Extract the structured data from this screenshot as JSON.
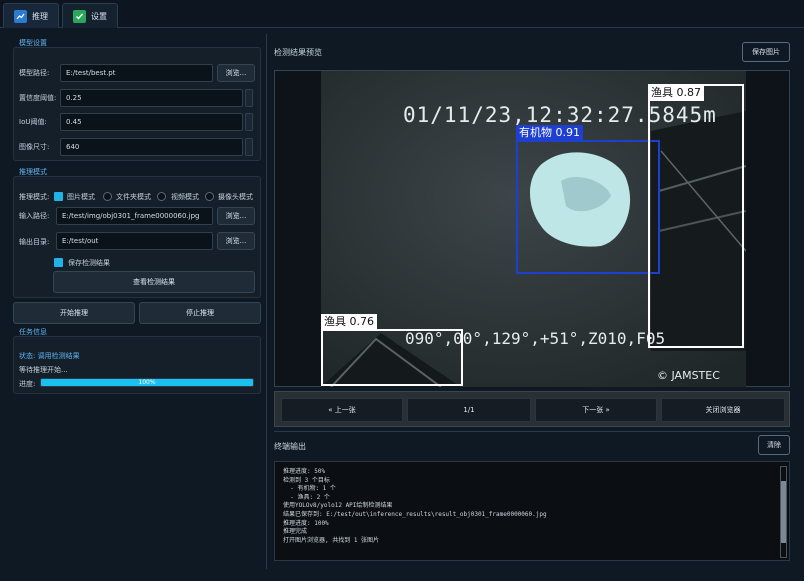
{
  "tabs": [
    {
      "label": "推理",
      "icon": "chart-line-icon"
    },
    {
      "label": "设置",
      "icon": "check-square-icon"
    }
  ],
  "model_settings": {
    "title": "模型设置",
    "model_path_label": "模型路径:",
    "model_path_value": "E:/test/best.pt",
    "browse_label": "浏览...",
    "conf_label": "置信度阈值:",
    "conf_value": "0.25",
    "iou_label": "IoU阈值:",
    "iou_value": "0.45",
    "imgsz_label": "图像尺寸:",
    "imgsz_value": "640"
  },
  "inference_mode": {
    "title": "推理模式",
    "mode_label": "推理模式:",
    "modes": [
      "图片模式",
      "文件夹模式",
      "视频模式",
      "摄像头模式"
    ],
    "selected_mode": "图片模式",
    "input_label": "输入路径:",
    "input_value": "E:/test/img/obj0301_frame0000060.jpg",
    "input_browse": "浏览...",
    "output_label": "输出目录:",
    "output_value": "E:/test/out",
    "output_browse": "浏览...",
    "save_label": "保存检测结果",
    "save_checked": true,
    "view_results": "查看检测结果"
  },
  "actions": {
    "start": "开始推理",
    "stop": "停止推理"
  },
  "task_info": {
    "title": "任务信息",
    "status": "状态: 调用检测结果",
    "waiting": "等待推理开始...",
    "progress_label": "进度:",
    "progress_text": "100%",
    "progress_value": 1.0
  },
  "preview": {
    "title": "检测结果预览",
    "save_image": "保存图片",
    "overlay_timestamp": "01/11/23,12:32:27.5845m",
    "overlay_coords": "090°,00°,129°,+51°,Z010,F05",
    "overlay_credit": "© JAMSTEC",
    "detections": [
      {
        "label": "有机物",
        "score": "0.91"
      },
      {
        "label": "渔具",
        "score": "0.87"
      },
      {
        "label": "渔具",
        "score": "0.76"
      }
    ],
    "colors": {
      "organic": "#1e3fd0",
      "gear": "#ffffff",
      "accent": "#21b3e8"
    }
  },
  "navigation": {
    "prev": "« 上一张",
    "page": "1/1",
    "next": "下一张 »",
    "close": "关闭浏览器"
  },
  "terminal": {
    "title": "终端输出",
    "clear": "清除",
    "lines": [
      "推理进度: 50%",
      "检测到 3 个目标",
      "  - 有机物: 1 个",
      "  - 渔具: 2 个",
      "使用YOLOv8/yolo12 API绘制检测结果",
      "结果已保存到: E:/test/out\\inference_results\\result_obj0301_frame0000060.jpg",
      "推理进度: 100%",
      "推理完成",
      "打开图片浏览器, 共找到 1 张图片"
    ]
  }
}
